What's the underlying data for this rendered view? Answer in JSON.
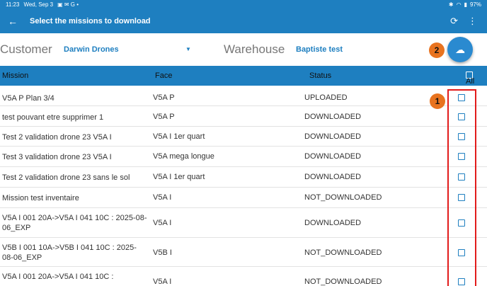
{
  "status_bar": {
    "time": "11:23",
    "date": "Wed, Sep 3",
    "battery": "97%"
  },
  "app_bar": {
    "title": "Select the missions to download"
  },
  "filters": {
    "customer_label": "Customer",
    "customer_value": "Darwin Drones",
    "warehouse_label": "Warehouse",
    "warehouse_value": "Baptiste test"
  },
  "badges": {
    "one": "1",
    "two": "2"
  },
  "table": {
    "headers": {
      "mission": "Mission",
      "face": "Face",
      "status": "Status",
      "all": "All"
    },
    "rows": [
      {
        "mission": "V5A P Plan 3/4",
        "face": "V5A P",
        "status": "UPLOADED"
      },
      {
        "mission": "test pouvant etre supprimer 1",
        "face": "V5A P",
        "status": "DOWNLOADED"
      },
      {
        "mission": "Test 2 validation drone 23 V5A I",
        "face": "V5A I 1er quart",
        "status": "DOWNLOADED"
      },
      {
        "mission": "Test 3 validation drone 23 V5A I",
        "face": "V5A mega longue",
        "status": "DOWNLOADED"
      },
      {
        "mission": "Test 2 validation drone 23 sans le sol",
        "face": "V5A I 1er quart",
        "status": "DOWNLOADED"
      },
      {
        "mission": "Mission test inventaire",
        "face": "V5A I",
        "status": "NOT_DOWNLOADED"
      },
      {
        "mission": "V5A I 001 20A->V5A I 041 10C : 2025-08-06_EXP",
        "face": "V5A I",
        "status": "DOWNLOADED"
      },
      {
        "mission": "V5B I 001 10A->V5B I 041 10C : 2025-08-06_EXP",
        "face": "V5B I",
        "status": "NOT_DOWNLOADED"
      },
      {
        "mission": "V5A I 001 20A->V5A I 041 10C :",
        "face": "V5A I",
        "status": "NOT_DOWNLOADED"
      }
    ]
  }
}
